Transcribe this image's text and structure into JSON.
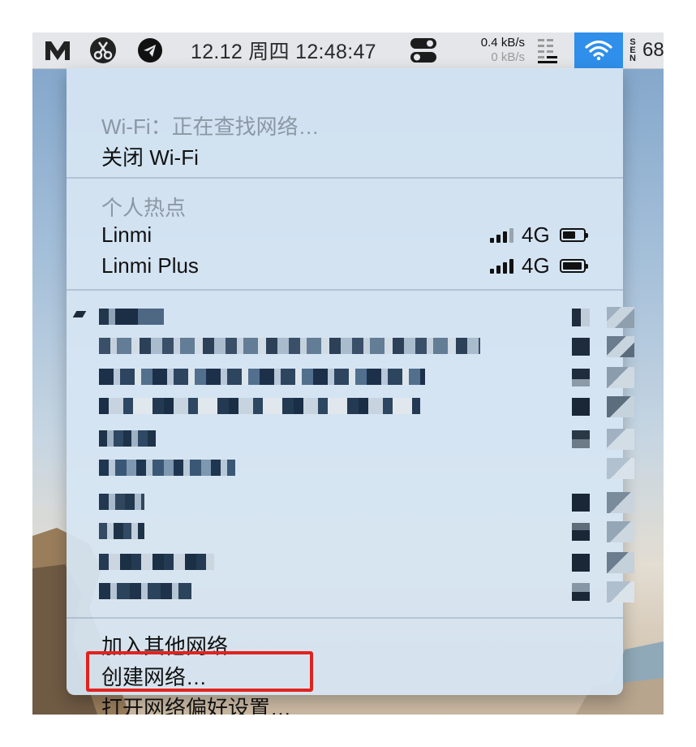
{
  "menubar": {
    "icons": [
      "m-logo-icon",
      "scissors-icon",
      "telegram-icon",
      "toggle-icon",
      "stack-bars-icon",
      "wifi-icon"
    ],
    "clock": "12.12 周四 12:48:47",
    "net_up": "0.4 kB/s",
    "net_down": "0 kB/s",
    "input_source": [
      "S",
      "E",
      "N"
    ],
    "trailing_number": "68"
  },
  "menu": {
    "status": "Wi-Fi：正在查找网络…",
    "toggle_wifi": "关闭 Wi-Fi",
    "hotspot_header": "个人热点",
    "hotspots": [
      {
        "name": "Linmi",
        "type": "4G",
        "signal": 3,
        "battery": 0.55
      },
      {
        "name": "Linmi Plus",
        "type": "4G",
        "signal": 4,
        "battery": 0.85
      }
    ],
    "join_other": "加入其他网络…",
    "create": "创建网络…",
    "open_prefs": "打开网络偏好设置…"
  },
  "colors": {
    "menubar_bg": "#e4e6e9",
    "menu_bg": "#d6e5f3",
    "wifi_active_bg": "#2f8fea",
    "highlight_border": "#e0231f",
    "dim_text": "#8b98a4"
  }
}
